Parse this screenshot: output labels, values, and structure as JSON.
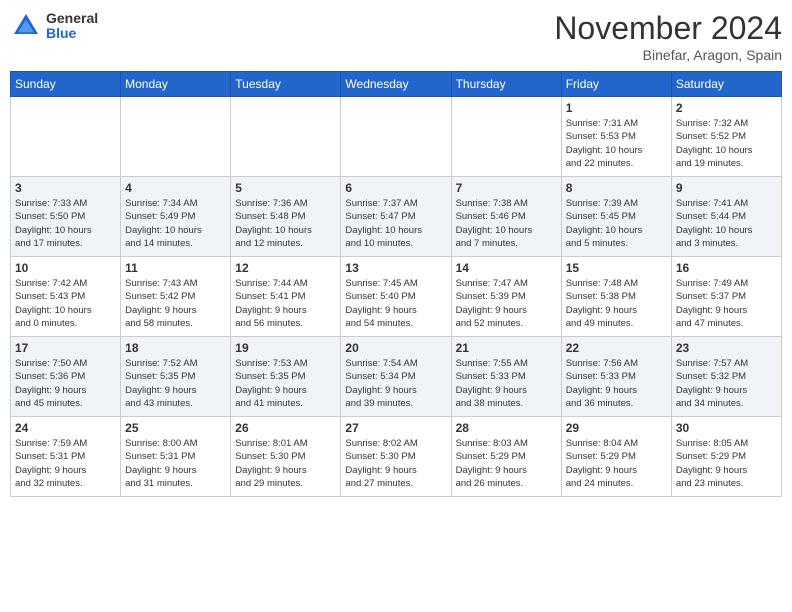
{
  "header": {
    "logo_general": "General",
    "logo_blue": "Blue",
    "month_title": "November 2024",
    "location": "Binefar, Aragon, Spain"
  },
  "weekdays": [
    "Sunday",
    "Monday",
    "Tuesday",
    "Wednesday",
    "Thursday",
    "Friday",
    "Saturday"
  ],
  "weeks": [
    [
      {
        "day": "",
        "info": ""
      },
      {
        "day": "",
        "info": ""
      },
      {
        "day": "",
        "info": ""
      },
      {
        "day": "",
        "info": ""
      },
      {
        "day": "",
        "info": ""
      },
      {
        "day": "1",
        "info": "Sunrise: 7:31 AM\nSunset: 5:53 PM\nDaylight: 10 hours\nand 22 minutes."
      },
      {
        "day": "2",
        "info": "Sunrise: 7:32 AM\nSunset: 5:52 PM\nDaylight: 10 hours\nand 19 minutes."
      }
    ],
    [
      {
        "day": "3",
        "info": "Sunrise: 7:33 AM\nSunset: 5:50 PM\nDaylight: 10 hours\nand 17 minutes."
      },
      {
        "day": "4",
        "info": "Sunrise: 7:34 AM\nSunset: 5:49 PM\nDaylight: 10 hours\nand 14 minutes."
      },
      {
        "day": "5",
        "info": "Sunrise: 7:36 AM\nSunset: 5:48 PM\nDaylight: 10 hours\nand 12 minutes."
      },
      {
        "day": "6",
        "info": "Sunrise: 7:37 AM\nSunset: 5:47 PM\nDaylight: 10 hours\nand 10 minutes."
      },
      {
        "day": "7",
        "info": "Sunrise: 7:38 AM\nSunset: 5:46 PM\nDaylight: 10 hours\nand 7 minutes."
      },
      {
        "day": "8",
        "info": "Sunrise: 7:39 AM\nSunset: 5:45 PM\nDaylight: 10 hours\nand 5 minutes."
      },
      {
        "day": "9",
        "info": "Sunrise: 7:41 AM\nSunset: 5:44 PM\nDaylight: 10 hours\nand 3 minutes."
      }
    ],
    [
      {
        "day": "10",
        "info": "Sunrise: 7:42 AM\nSunset: 5:43 PM\nDaylight: 10 hours\nand 0 minutes."
      },
      {
        "day": "11",
        "info": "Sunrise: 7:43 AM\nSunset: 5:42 PM\nDaylight: 9 hours\nand 58 minutes."
      },
      {
        "day": "12",
        "info": "Sunrise: 7:44 AM\nSunset: 5:41 PM\nDaylight: 9 hours\nand 56 minutes."
      },
      {
        "day": "13",
        "info": "Sunrise: 7:45 AM\nSunset: 5:40 PM\nDaylight: 9 hours\nand 54 minutes."
      },
      {
        "day": "14",
        "info": "Sunrise: 7:47 AM\nSunset: 5:39 PM\nDaylight: 9 hours\nand 52 minutes."
      },
      {
        "day": "15",
        "info": "Sunrise: 7:48 AM\nSunset: 5:38 PM\nDaylight: 9 hours\nand 49 minutes."
      },
      {
        "day": "16",
        "info": "Sunrise: 7:49 AM\nSunset: 5:37 PM\nDaylight: 9 hours\nand 47 minutes."
      }
    ],
    [
      {
        "day": "17",
        "info": "Sunrise: 7:50 AM\nSunset: 5:36 PM\nDaylight: 9 hours\nand 45 minutes."
      },
      {
        "day": "18",
        "info": "Sunrise: 7:52 AM\nSunset: 5:35 PM\nDaylight: 9 hours\nand 43 minutes."
      },
      {
        "day": "19",
        "info": "Sunrise: 7:53 AM\nSunset: 5:35 PM\nDaylight: 9 hours\nand 41 minutes."
      },
      {
        "day": "20",
        "info": "Sunrise: 7:54 AM\nSunset: 5:34 PM\nDaylight: 9 hours\nand 39 minutes."
      },
      {
        "day": "21",
        "info": "Sunrise: 7:55 AM\nSunset: 5:33 PM\nDaylight: 9 hours\nand 38 minutes."
      },
      {
        "day": "22",
        "info": "Sunrise: 7:56 AM\nSunset: 5:33 PM\nDaylight: 9 hours\nand 36 minutes."
      },
      {
        "day": "23",
        "info": "Sunrise: 7:57 AM\nSunset: 5:32 PM\nDaylight: 9 hours\nand 34 minutes."
      }
    ],
    [
      {
        "day": "24",
        "info": "Sunrise: 7:59 AM\nSunset: 5:31 PM\nDaylight: 9 hours\nand 32 minutes."
      },
      {
        "day": "25",
        "info": "Sunrise: 8:00 AM\nSunset: 5:31 PM\nDaylight: 9 hours\nand 31 minutes."
      },
      {
        "day": "26",
        "info": "Sunrise: 8:01 AM\nSunset: 5:30 PM\nDaylight: 9 hours\nand 29 minutes."
      },
      {
        "day": "27",
        "info": "Sunrise: 8:02 AM\nSunset: 5:30 PM\nDaylight: 9 hours\nand 27 minutes."
      },
      {
        "day": "28",
        "info": "Sunrise: 8:03 AM\nSunset: 5:29 PM\nDaylight: 9 hours\nand 26 minutes."
      },
      {
        "day": "29",
        "info": "Sunrise: 8:04 AM\nSunset: 5:29 PM\nDaylight: 9 hours\nand 24 minutes."
      },
      {
        "day": "30",
        "info": "Sunrise: 8:05 AM\nSunset: 5:29 PM\nDaylight: 9 hours\nand 23 minutes."
      }
    ]
  ]
}
